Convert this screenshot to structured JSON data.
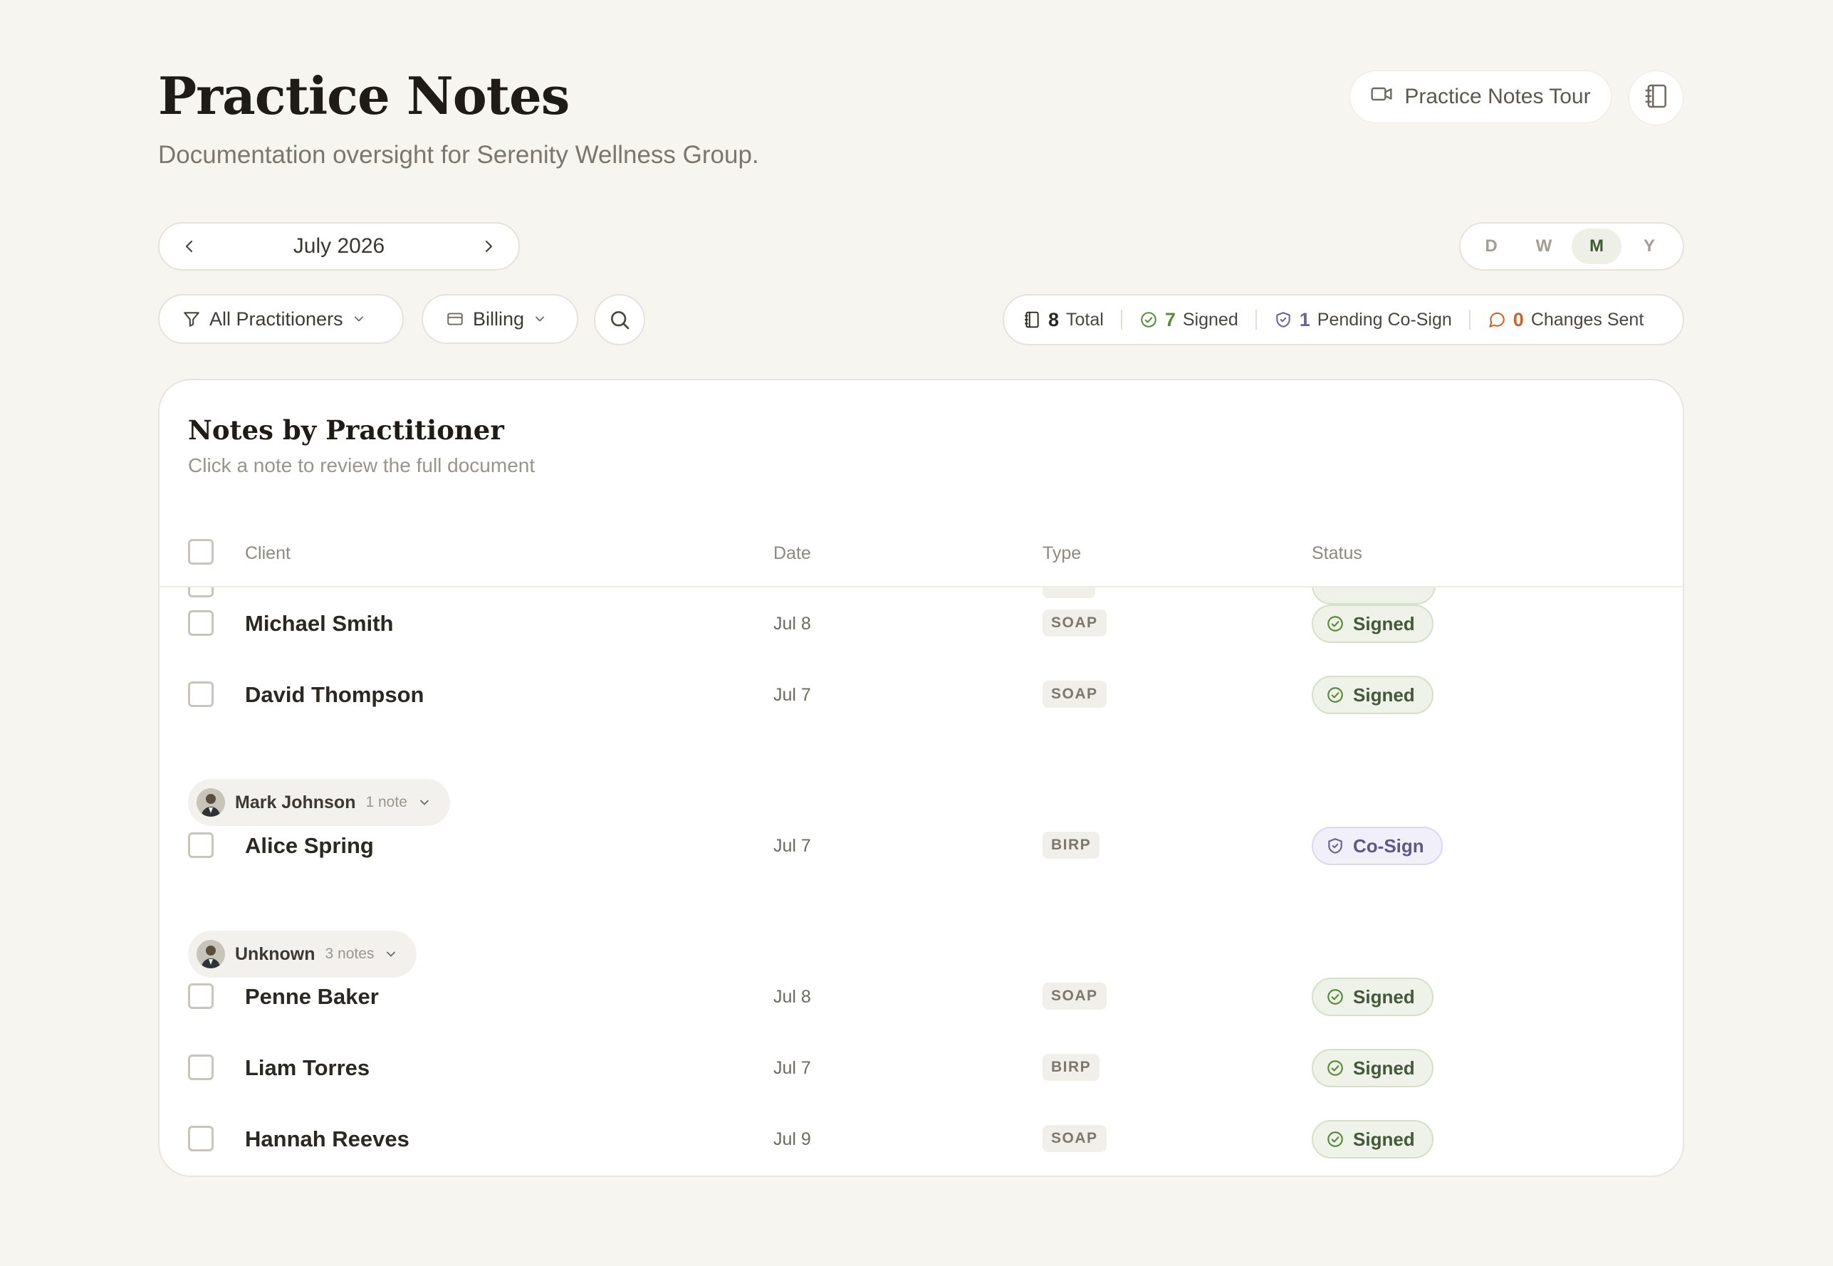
{
  "header": {
    "title": "Practice Notes",
    "subtitle": "Documentation oversight for Serenity Wellness Group.",
    "tour_button": "Practice Notes Tour"
  },
  "period": {
    "label": "July 2026",
    "options": [
      "D",
      "W",
      "M",
      "Y"
    ],
    "selected": "M"
  },
  "filters": {
    "practitioners": "All Practitioners",
    "billing": "Billing"
  },
  "stats": {
    "total_count": "8",
    "total_label": "Total",
    "signed_count": "7",
    "signed_label": "Signed",
    "pending_count": "1",
    "pending_label": "Pending Co-Sign",
    "changes_count": "0",
    "changes_label": "Changes Sent"
  },
  "card": {
    "title": "Notes by Practitioner",
    "subtitle": "Click a note to review the full document",
    "columns": {
      "client": "Client",
      "date": "Date",
      "type": "Type",
      "status": "Status"
    }
  },
  "rows": {
    "r1": {
      "client": "Michael Smith",
      "date": "Jul 8",
      "type": "SOAP",
      "status": "Signed"
    },
    "r2": {
      "client": "David Thompson",
      "date": "Jul 7",
      "type": "SOAP",
      "status": "Signed"
    },
    "g1": {
      "name": "Mark Johnson",
      "count": "1 note"
    },
    "r3": {
      "client": "Alice Spring",
      "date": "Jul 7",
      "type": "BIRP",
      "status": "Co-Sign"
    },
    "g2": {
      "name": "Unknown",
      "count": "3 notes"
    },
    "r4": {
      "client": "Penne Baker",
      "date": "Jul 8",
      "type": "SOAP",
      "status": "Signed"
    },
    "r5": {
      "client": "Liam Torres",
      "date": "Jul 7",
      "type": "BIRP",
      "status": "Signed"
    },
    "r6": {
      "client": "Hannah Reeves",
      "date": "Jul 9",
      "type": "SOAP",
      "status": "Signed"
    }
  },
  "colors": {
    "background": "#f7f5f0",
    "signed_green": "#5b8a3c",
    "cosign_purple": "#6b6391",
    "changes_orange": "#c8652f"
  }
}
